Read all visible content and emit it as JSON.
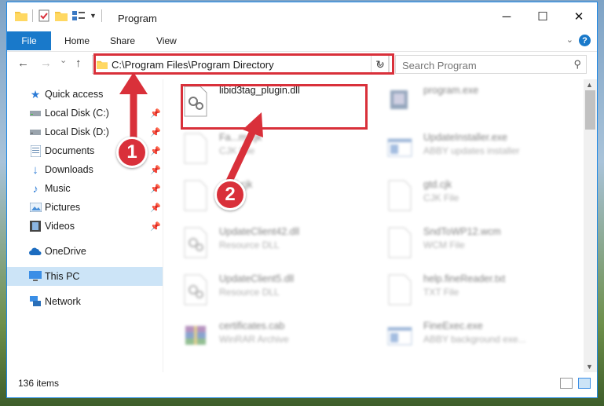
{
  "window": {
    "title": "Program",
    "controls": {
      "minimize": "─",
      "maximize": "☐",
      "close": "✕"
    }
  },
  "ribbon": {
    "tabs": [
      "File",
      "Home",
      "Share",
      "View"
    ],
    "help": "?"
  },
  "navigation": {
    "back": "←",
    "forward": "→",
    "recent": "⌄",
    "up": "↑",
    "address": "C:\\Program Files\\Program Directory",
    "search_placeholder": "Search Program"
  },
  "sidebar": {
    "items": [
      {
        "label": "Quick access",
        "icon": "star-icon",
        "pinned": false
      },
      {
        "label": "Local Disk (C:)",
        "icon": "drive-icon",
        "pinned": true
      },
      {
        "label": "Local Disk (D:)",
        "icon": "drive-icon",
        "pinned": true
      },
      {
        "label": "Documents",
        "icon": "documents-icon",
        "pinned": true
      },
      {
        "label": "Downloads",
        "icon": "download-icon",
        "pinned": true
      },
      {
        "label": "Music",
        "icon": "music-icon",
        "pinned": true
      },
      {
        "label": "Pictures",
        "icon": "pictures-icon",
        "pinned": true
      },
      {
        "label": "Videos",
        "icon": "videos-icon",
        "pinned": true
      },
      {
        "label": "OneDrive",
        "icon": "cloud-icon",
        "pinned": false
      },
      {
        "label": "This PC",
        "icon": "computer-icon",
        "pinned": false,
        "selected": true
      },
      {
        "label": "Network",
        "icon": "network-icon",
        "pinned": false
      }
    ]
  },
  "files": [
    {
      "name": "libid3tag_plugin.dll",
      "type": "",
      "icon": "dll-gear-icon",
      "highlighted": true
    },
    {
      "name": "program.exe",
      "type": "",
      "icon": "exe-icon"
    },
    {
      "name": "Fa...m.cjk",
      "type": "CJK File",
      "icon": "blank-file-icon"
    },
    {
      "name": "UpdateInstaller.exe",
      "type": "ABBY updates installer",
      "icon": "exe-window-icon"
    },
    {
      "name": "...ml.cjk",
      "type": "...",
      "icon": "blank-file-icon"
    },
    {
      "name": "gtd.cjk",
      "type": "CJK File",
      "icon": "blank-file-icon"
    },
    {
      "name": "UpdateClient42.dll",
      "type": "Resource DLL",
      "icon": "dll-gear-icon"
    },
    {
      "name": "SndToWP12.wcm",
      "type": "WCM File",
      "icon": "blank-file-icon"
    },
    {
      "name": "UpdateClient5.dll",
      "type": "Resource DLL",
      "icon": "dll-gear-icon"
    },
    {
      "name": "help.fineReader.txt",
      "type": "TXT File",
      "icon": "blank-file-icon"
    },
    {
      "name": "certificates.cab",
      "type": "WinRAR Archive",
      "icon": "archive-icon"
    },
    {
      "name": "FineExec.exe",
      "type": "ABBY background exe...",
      "icon": "exe-window-icon"
    }
  ],
  "status": {
    "item_count": "136 items"
  },
  "callouts": {
    "step1": "1",
    "step2": "2"
  },
  "colors": {
    "accent": "#1979ca",
    "callout_red": "#d9303a",
    "selected_bg": "#cce4f7"
  }
}
